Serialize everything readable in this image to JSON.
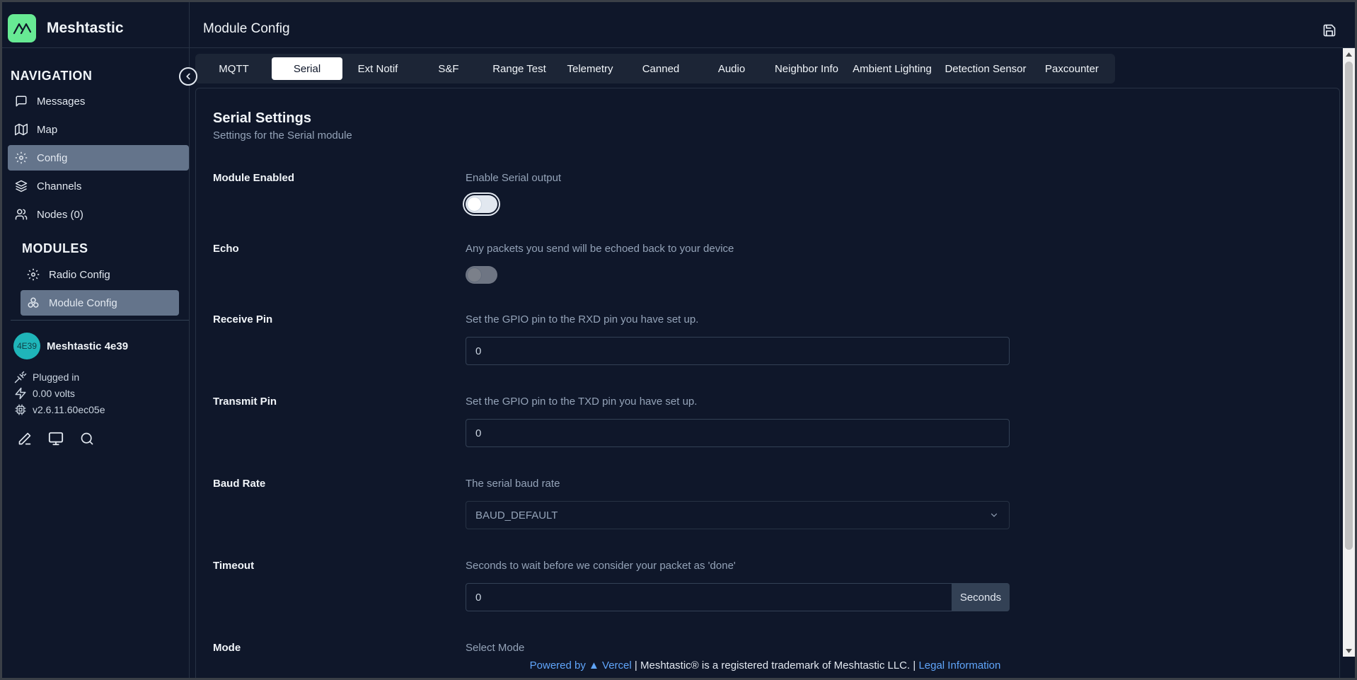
{
  "app": {
    "name": "Meshtastic"
  },
  "sidebar": {
    "nav_title": "NAVIGATION",
    "items": [
      {
        "label": "Messages",
        "icon": "message-square-icon"
      },
      {
        "label": "Map",
        "icon": "map-icon"
      },
      {
        "label": "Config",
        "icon": "gear-icon",
        "active": true
      },
      {
        "label": "Channels",
        "icon": "layers-icon"
      },
      {
        "label": "Nodes (0)",
        "icon": "users-icon"
      }
    ],
    "modules_title": "MODULES",
    "modules": [
      {
        "label": "Radio Config",
        "icon": "gear-icon"
      },
      {
        "label": "Module Config",
        "icon": "boxes-icon",
        "active": true
      }
    ],
    "device": {
      "avatar": "4E39",
      "name": "Meshtastic 4e39",
      "power": "Plugged in",
      "voltage": "0.00 volts",
      "firmware": "v2.6.11.60ec05e"
    }
  },
  "header": {
    "title": "Module Config"
  },
  "tabs": [
    "MQTT",
    "Serial",
    "Ext Notif",
    "S&F",
    "Range Test",
    "Telemetry",
    "Canned",
    "Audio",
    "Neighbor Info",
    "Ambient Lighting",
    "Detection Sensor",
    "Paxcounter"
  ],
  "active_tab": "Serial",
  "section": {
    "title": "Serial Settings",
    "subtitle": "Settings for the Serial module"
  },
  "fields": {
    "enabled": {
      "label": "Module Enabled",
      "desc": "Enable Serial output",
      "value": false
    },
    "echo": {
      "label": "Echo",
      "desc": "Any packets you send will be echoed back to your device",
      "value": false,
      "disabled": true
    },
    "rxd": {
      "label": "Receive Pin",
      "desc": "Set the GPIO pin to the RXD pin you have set up.",
      "value": "0"
    },
    "txd": {
      "label": "Transmit Pin",
      "desc": "Set the GPIO pin to the TXD pin you have set up.",
      "value": "0"
    },
    "baud": {
      "label": "Baud Rate",
      "desc": "The serial baud rate",
      "value": "BAUD_DEFAULT"
    },
    "timeout": {
      "label": "Timeout",
      "desc": "Seconds to wait before we consider your packet as 'done'",
      "value": "0",
      "suffix": "Seconds"
    },
    "mode": {
      "label": "Mode",
      "desc": "Select Mode"
    }
  },
  "footer": {
    "powered": "Powered by ▲ Vercel",
    "trademark": "Meshtastic® is a registered trademark of Meshtastic LLC.",
    "legal": "Legal Information"
  },
  "colors": {
    "brand": "#67ea94",
    "active_nav": "#64748b",
    "link": "#60a5fa",
    "avatar": "#1fb5b9"
  }
}
